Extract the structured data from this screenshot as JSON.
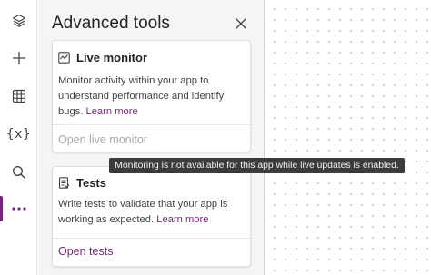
{
  "panel": {
    "title": "Advanced tools",
    "cards": [
      {
        "title": "Live monitor",
        "description": "Monitor activity within your app to understand performance and identify bugs.",
        "learn_more": "Learn more",
        "action": "Open live monitor",
        "action_enabled": false
      },
      {
        "title": "Tests",
        "description": "Write tests to validate that your app is working as expected.",
        "learn_more": "Learn more",
        "action": "Open tests",
        "action_enabled": true
      }
    ]
  },
  "rail": {
    "items": [
      {
        "icon": "layers-icon"
      },
      {
        "icon": "plus-icon"
      },
      {
        "icon": "table-icon"
      },
      {
        "icon": "variables-icon",
        "label": "{x}"
      },
      {
        "icon": "search-icon"
      },
      {
        "icon": "more-icon",
        "active": true
      }
    ]
  },
  "tooltip": {
    "text": "Monitoring is not available for this app while live updates is enabled."
  },
  "colors": {
    "accent": "#742774",
    "panel_bg": "#f5f5f5",
    "tooltip_bg": "#3b3b3b"
  }
}
